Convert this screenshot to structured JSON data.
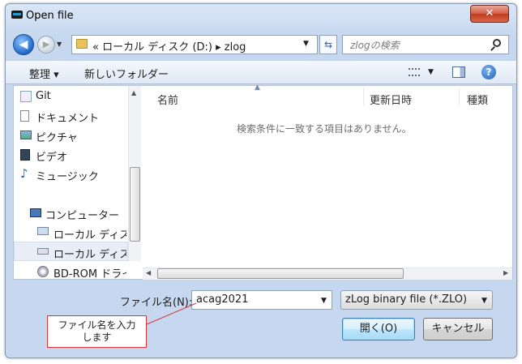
{
  "window": {
    "title": "Open file",
    "close_glyph": "✕"
  },
  "nav": {
    "back_glyph": "◀",
    "forward_glyph": "▶",
    "address": "«  ローカル ディスク (D:)  ▸  zlog",
    "refresh_glyph": "⇆",
    "search_placeholder": "zlogの検索"
  },
  "toolbar": {
    "organize": "整理 ▾",
    "new_folder": "新しいフォルダー",
    "help_glyph": "?"
  },
  "sidebar": {
    "items": [
      {
        "label": "Git",
        "icon": "git-folder-icon"
      },
      {
        "label": "ドキュメント",
        "icon": "document-icon"
      },
      {
        "label": "ピクチャ",
        "icon": "picture-icon"
      },
      {
        "label": "ビデオ",
        "icon": "video-icon"
      },
      {
        "label": "ミュージック",
        "icon": "music-icon"
      },
      {
        "label": "コンピューター",
        "icon": "computer-icon"
      },
      {
        "label": "ローカル ディスク",
        "icon": "drive-icon"
      },
      {
        "label": "ローカル ディスク",
        "icon": "drive-icon"
      },
      {
        "label": "BD-ROM ドライブ",
        "icon": "disc-icon"
      }
    ]
  },
  "columns": {
    "name": "名前",
    "modified": "更新日時",
    "type": "種類"
  },
  "empty_message": "検索条件に一致する項目はありません。",
  "footer": {
    "filename_label": "ファイル名(N):",
    "filename_value": "acag2021",
    "filetype": "zLog binary file (*.ZLO)",
    "open_label": "開く(O)",
    "cancel_label": "キャンセル"
  },
  "callout": {
    "line1": "ファイル名を入力",
    "line2": "します"
  }
}
